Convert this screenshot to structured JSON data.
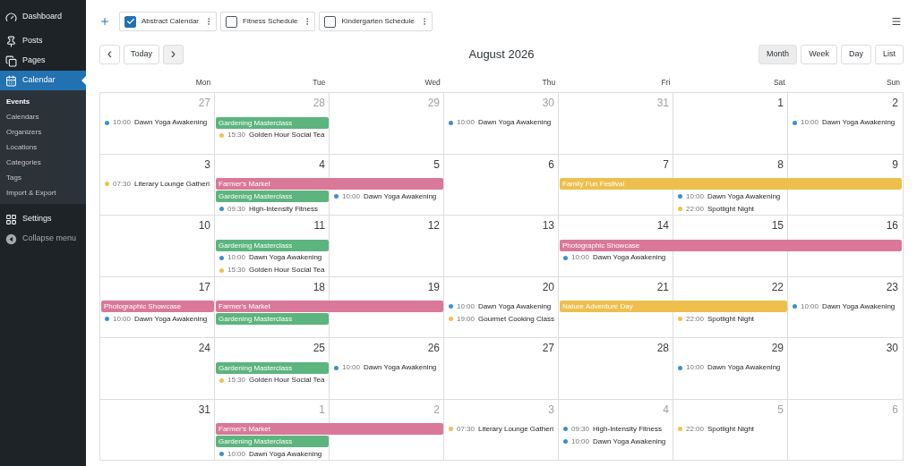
{
  "sidebar": {
    "items": [
      {
        "label": "Dashboard",
        "kind": "dashboard",
        "selected": false
      },
      {
        "label": "Posts",
        "kind": "posts",
        "selected": false
      },
      {
        "label": "Pages",
        "kind": "pages",
        "selected": false
      },
      {
        "label": "Calendar",
        "kind": "calendar",
        "selected": true,
        "children": [
          {
            "label": "Events",
            "selected": true
          },
          {
            "label": "Calendars",
            "selected": false
          },
          {
            "label": "Organizers",
            "selected": false
          },
          {
            "label": "Locations",
            "selected": false
          },
          {
            "label": "Categories",
            "selected": false
          },
          {
            "label": "Tags",
            "selected": false
          },
          {
            "label": "Import & Export",
            "selected": false
          }
        ]
      },
      {
        "label": "Settings",
        "kind": "settings",
        "selected": false
      },
      {
        "label": "Collapse menu",
        "kind": "collapse",
        "selected": false
      }
    ]
  },
  "calendars": [
    {
      "label": "Abstract Calendar",
      "checked": true
    },
    {
      "label": "Fitness Schedule",
      "checked": false
    },
    {
      "label": "Kindergarten Schedule",
      "checked": false
    }
  ],
  "toolbar": {
    "prev": "‹",
    "today": "Today",
    "next": "›",
    "title": "August 2026",
    "views": [
      {
        "label": "Month",
        "selected": true
      },
      {
        "label": "Week",
        "selected": false
      },
      {
        "label": "Day",
        "selected": false
      },
      {
        "label": "List",
        "selected": false
      }
    ]
  },
  "weekdays": [
    "Mon",
    "Tue",
    "Wed",
    "Thu",
    "Fri",
    "Sat",
    "Sun"
  ],
  "weeks": [
    {
      "days": [
        {
          "number": "27",
          "other_month": true,
          "events": [
            {
              "kind": "dot",
              "time": "10:00",
              "title": "Dawn Yoga Awakening",
              "color": "#3d8fd1"
            }
          ]
        },
        {
          "number": "28",
          "other_month": true,
          "events": [
            {
              "kind": "bar",
              "title": "Gardening Masterclass",
              "color": "#5cb47e"
            },
            {
              "kind": "dot",
              "time": "15:30",
              "title": "Golden Hour Social Tea",
              "color": "#efc24f"
            }
          ]
        },
        {
          "number": "29",
          "other_month": true
        },
        {
          "number": "30",
          "other_month": true,
          "events": [
            {
              "kind": "dot",
              "time": "10:00",
              "title": "Dawn Yoga Awakening",
              "color": "#3d8fd1"
            }
          ]
        },
        {
          "number": "31",
          "other_month": true
        },
        {
          "number": "1",
          "other_month": false
        },
        {
          "number": "2",
          "other_month": false,
          "events": [
            {
              "kind": "dot",
              "time": "10:00",
              "title": "Dawn Yoga Awakening",
              "color": "#3d8fd1"
            }
          ]
        }
      ]
    },
    {
      "days": [
        {
          "number": "3",
          "other_month": false,
          "events": [
            {
              "kind": "dot",
              "time": "07:30",
              "title": "Literary Lounge Gatheri",
              "color": "#efc24f"
            }
          ]
        },
        {
          "number": "4",
          "other_month": false,
          "events": [
            {
              "kind": "bar",
              "title": "Farmer's Market",
              "color": "#d97899"
            },
            {
              "kind": "bar",
              "title": "Gardening Masterclass",
              "color": "#5cb47e"
            },
            {
              "kind": "dot",
              "time": "09:30",
              "title": "High-Intensity Fitness",
              "color": "#3d8fd1"
            }
          ]
        },
        {
          "number": "5",
          "other_month": false,
          "events": [
            {
              "kind": "continuation"
            },
            {
              "kind": "dot",
              "time": "10:00",
              "title": "Dawn Yoga Awakening",
              "color": "#3d8fd1"
            }
          ]
        },
        {
          "number": "6",
          "other_month": false
        },
        {
          "number": "7",
          "other_month": false,
          "events": [
            {
              "kind": "bar",
              "title": "Family Fun Festival",
              "color": "#edbf4d"
            }
          ]
        },
        {
          "number": "8",
          "other_month": false,
          "events": [
            {
              "kind": "continuation"
            },
            {
              "kind": "dot",
              "time": "10:00",
              "title": "Dawn Yoga Awakening",
              "color": "#3d8fd1"
            },
            {
              "kind": "dot",
              "time": "22:00",
              "title": "Spotlight Night",
              "color": "#efc24f"
            }
          ]
        },
        {
          "number": "9",
          "other_month": false,
          "events": [
            {
              "kind": "continuation"
            }
          ]
        }
      ]
    },
    {
      "days": [
        {
          "number": "10",
          "other_month": false
        },
        {
          "number": "11",
          "other_month": false,
          "events": [
            {
              "kind": "bar",
              "title": "Gardening Masterclass",
              "color": "#5cb47e"
            },
            {
              "kind": "dot",
              "time": "10:00",
              "title": "Dawn Yoga Awakening",
              "color": "#3d8fd1"
            },
            {
              "kind": "dot",
              "time": "15:30",
              "title": "Golden Hour Social Tea",
              "color": "#efc24f"
            }
          ]
        },
        {
          "number": "12",
          "other_month": false
        },
        {
          "number": "13",
          "other_month": false
        },
        {
          "number": "14",
          "other_month": false,
          "events": [
            {
              "kind": "bar",
              "title": "Photographic Showcase",
              "color": "#d97899"
            },
            {
              "kind": "dot",
              "time": "10:00",
              "title": "Dawn Yoga Awakening",
              "color": "#3d8fd1"
            }
          ]
        },
        {
          "number": "15",
          "other_month": false,
          "events": [
            {
              "kind": "continuation"
            }
          ]
        },
        {
          "number": "16",
          "other_month": false,
          "events": [
            {
              "kind": "continuation"
            }
          ]
        }
      ]
    },
    {
      "days": [
        {
          "number": "17",
          "other_month": false,
          "events": [
            {
              "kind": "bar",
              "title": "Photographic Showcase",
              "color": "#d97899"
            },
            {
              "kind": "dot",
              "time": "10:00",
              "title": "Dawn Yoga Awakening",
              "color": "#3d8fd1"
            }
          ]
        },
        {
          "number": "18",
          "other_month": false,
          "events": [
            {
              "kind": "bar",
              "title": "Farmer's Market",
              "color": "#d97899"
            },
            {
              "kind": "bar",
              "title": "Gardening Masterclass",
              "color": "#5cb47e"
            }
          ]
        },
        {
          "number": "19",
          "other_month": false,
          "events": [
            {
              "kind": "continuation"
            }
          ]
        },
        {
          "number": "20",
          "other_month": false,
          "events": [
            {
              "kind": "dot",
              "time": "10:00",
              "title": "Dawn Yoga Awakening",
              "color": "#3d8fd1"
            },
            {
              "kind": "dot",
              "time": "19:00",
              "title": "Gourmet Cooking Class",
              "color": "#efc24f"
            }
          ]
        },
        {
          "number": "21",
          "other_month": false,
          "events": [
            {
              "kind": "bar",
              "title": "Nature Adventure Day",
              "color": "#edbf4d"
            }
          ]
        },
        {
          "number": "22",
          "other_month": false,
          "events": [
            {
              "kind": "continuation"
            },
            {
              "kind": "dot",
              "time": "22:00",
              "title": "Spotlight Night",
              "color": "#efc24f"
            }
          ]
        },
        {
          "number": "23",
          "other_month": false,
          "events": [
            {
              "kind": "dot",
              "time": "10:00",
              "title": "Dawn Yoga Awakening",
              "color": "#3d8fd1"
            }
          ]
        }
      ]
    },
    {
      "days": [
        {
          "number": "24",
          "other_month": false
        },
        {
          "number": "25",
          "other_month": false,
          "events": [
            {
              "kind": "bar",
              "title": "Gardening Masterclass",
              "color": "#5cb47e"
            },
            {
              "kind": "dot",
              "time": "15:30",
              "title": "Golden Hour Social Tea",
              "color": "#efc24f"
            }
          ]
        },
        {
          "number": "26",
          "other_month": false,
          "events": [
            {
              "kind": "dot",
              "time": "10:00",
              "title": "Dawn Yoga Awakening",
              "color": "#3d8fd1"
            }
          ]
        },
        {
          "number": "27",
          "other_month": false
        },
        {
          "number": "28",
          "other_month": false
        },
        {
          "number": "29",
          "other_month": false,
          "events": [
            {
              "kind": "dot",
              "time": "10:00",
              "title": "Dawn Yoga Awakening",
              "color": "#3d8fd1"
            }
          ]
        },
        {
          "number": "30",
          "other_month": false
        }
      ]
    },
    {
      "days": [
        {
          "number": "31",
          "other_month": false
        },
        {
          "number": "1",
          "other_month": true,
          "events": [
            {
              "kind": "bar",
              "title": "Farmer's Market",
              "color": "#d97899"
            },
            {
              "kind": "bar",
              "title": "Gardening Masterclass",
              "color": "#5cb47e"
            },
            {
              "kind": "dot",
              "time": "10:00",
              "title": "Dawn Yoga Awakening",
              "color": "#3d8fd1"
            }
          ]
        },
        {
          "number": "2",
          "other_month": true,
          "events": [
            {
              "kind": "continuation"
            }
          ]
        },
        {
          "number": "3",
          "other_month": true,
          "events": [
            {
              "kind": "dot",
              "time": "07:30",
              "title": "Literary Lounge Gatheri",
              "color": "#efc24f"
            }
          ]
        },
        {
          "number": "4",
          "other_month": true,
          "events": [
            {
              "kind": "dot",
              "time": "09:30",
              "title": "High-Intensity Fitness",
              "color": "#3d8fd1"
            },
            {
              "kind": "dot",
              "time": "10:00",
              "title": "Dawn Yoga Awakening",
              "color": "#3d8fd1"
            }
          ]
        },
        {
          "number": "5",
          "other_month": true,
          "events": [
            {
              "kind": "dot",
              "time": "22:00",
              "title": "Spotlight Night",
              "color": "#efc24f"
            }
          ]
        },
        {
          "number": "6",
          "other_month": true
        }
      ]
    }
  ]
}
